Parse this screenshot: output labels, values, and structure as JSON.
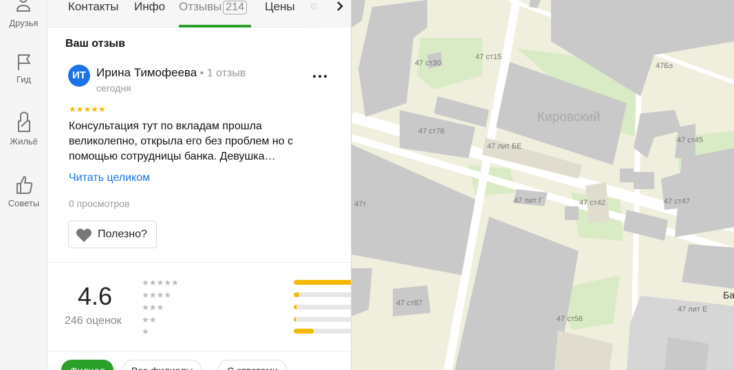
{
  "rail": {
    "items": [
      {
        "label": "Друзья"
      },
      {
        "label": "Гид"
      },
      {
        "label": "Жильё"
      },
      {
        "label": "Советы"
      }
    ]
  },
  "tabs": {
    "items": [
      "Контакты",
      "Инфо",
      "Отзывы",
      "Цены",
      "Ф"
    ],
    "reviews_count": "214",
    "active": "Отзывы"
  },
  "my_review": {
    "section_title": "Ваш отзыв",
    "avatar_initials": "ИТ",
    "author": "Ирина Тимофеева",
    "author_meta": " • 1 отзыв",
    "date": "сегодня",
    "stars": "★★★★★",
    "rating": 5,
    "text": "Консультация тут по вкладам прошла великолепно, открыла его без проблем но с помощью сотрудницы банка. Девушка…",
    "read_more": "Читать целиком",
    "views": "0 просмотров",
    "helpful_label": "Полезно?"
  },
  "summary": {
    "rating": "4.6",
    "count": "246 оценок",
    "rows": [
      {
        "stars": "★★★★★",
        "fraction": 1.0
      },
      {
        "stars": "★★★★",
        "fraction": 0.04
      },
      {
        "stars": "★★★",
        "fraction": 0.02
      },
      {
        "stars": "★★",
        "fraction": 0.01
      },
      {
        "stars": "★",
        "fraction": 0.15
      }
    ]
  },
  "filters": [
    "Филиал",
    "Все филиалы",
    "С ответами"
  ],
  "map": {
    "district": "Кировский",
    "edge_label": "Ба",
    "labels": [
      "47 ст30",
      "47 ст15",
      "47Бэ",
      "47 ст76",
      "47 лит БЕ",
      "47 ст45",
      "47т",
      "47 лит Г",
      "47 ст42",
      "47 ст47",
      "47 ст87",
      "47 ст56",
      "47 лит Е"
    ]
  },
  "colors": {
    "accent_green": "#2ba02b",
    "star_yellow": "#f5b900",
    "link_blue": "#1a73e8",
    "map_building": "#c9c9c9",
    "map_park": "#d8ebc4"
  }
}
